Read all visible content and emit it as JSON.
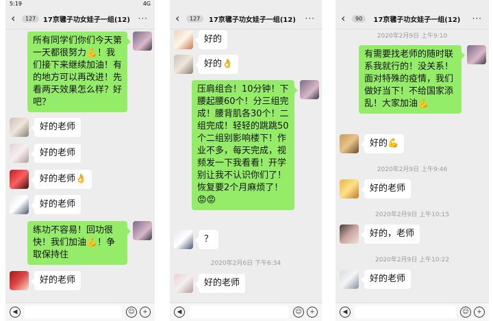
{
  "panels": [
    {
      "status_time": "5:19",
      "status_signal": "4G",
      "back_count": "127",
      "title": "17京毽子功女娃子一组(12)",
      "more": "···",
      "messages": [
        {
          "text": "所有同学们你们今天第一天都很努力💪！我们接下来继续加油！有的地方可以再改进！先看两天效果怎么样？好吧？"
        },
        {
          "text": "好的老师"
        },
        {
          "text": "好的老师"
        },
        {
          "text": "好的老师👌"
        },
        {
          "text": "好的老师"
        },
        {
          "text": "练功不容易！回功很快！我们加油💪！争取保持住"
        },
        {
          "text": "好的老师"
        }
      ]
    },
    {
      "back_count": "127",
      "title": "17京毽子功女娃子一组(12)",
      "more": "···",
      "messages": [
        {
          "text": "好的"
        },
        {
          "text": "好的👌"
        },
        {
          "text": "压肩组合！10分钟！下腰起腰60个！分三组完成！腰背肌各30个！二组完成！轻轻的跳跳50个二组别影响楼下！作业不多，每天完成，视频发一下我看看！开学别让我不认识你们了！恢复要2个月麻烦了！😡😡"
        },
        {
          "text": "？"
        },
        {
          "text": "好的老师"
        }
      ],
      "timestamps": [
        "2020年2月6日 下午6:34"
      ]
    },
    {
      "back_count": "90",
      "title": "17京毽子功女娃子一组(12)",
      "more": "···",
      "messages": [
        {
          "text": "有需要找老师的随时联系我就行的！没关系！面对特殊的疫情，我们做好当下！不给国家添乱！大家加油💪"
        },
        {
          "text": "好的💪"
        },
        {
          "text": "好的老师"
        },
        {
          "text": "好的，老师"
        },
        {
          "text": "好的老师"
        }
      ],
      "timestamps": [
        "2020年2月9日 上午9:10",
        "2020年2月9日 上午9:46",
        "2020年2月9日 上午10:15",
        "2020年2月9日 上午10:22"
      ]
    }
  ],
  "input_icons": {
    "voice": "voice-icon",
    "emoji": "emoji-icon",
    "plus": "plus-icon"
  },
  "colors": {
    "outgoing_bubble": "#95ec69",
    "incoming_bubble": "#ffffff",
    "chat_bg": "#ededed"
  }
}
